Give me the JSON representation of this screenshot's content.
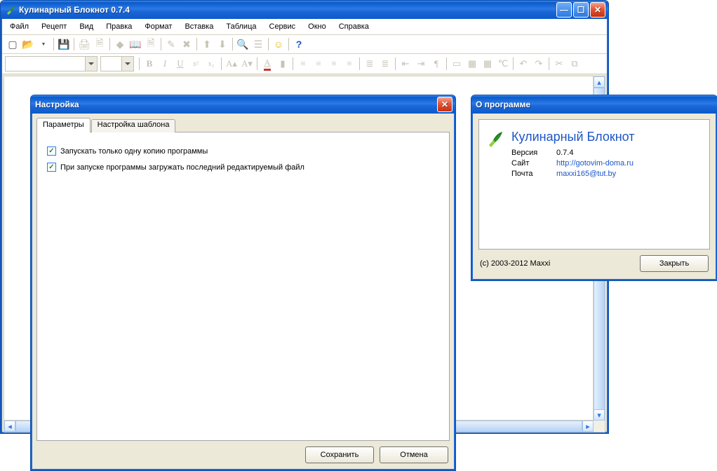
{
  "main": {
    "title": "Кулинарный Блокнот 0.7.4",
    "menu": [
      "Файл",
      "Рецепт",
      "Вид",
      "Правка",
      "Формат",
      "Вставка",
      "Таблица",
      "Сервис",
      "Окно",
      "Справка"
    ]
  },
  "settings": {
    "title": "Настройка",
    "tabs": [
      "Параметры",
      "Настройка шаблона"
    ],
    "checkbox1": "Запускать только одну копию программы",
    "checkbox2": "При запуске программы загружать последний редактируемый файл",
    "save": "Сохранить",
    "cancel": "Отмена"
  },
  "about": {
    "title": "О программе",
    "product": "Кулинарный Блокнот",
    "version_label": "Версия",
    "version_value": "0.7.4",
    "site_label": "Сайт",
    "site_value": "http://gotovim-doma.ru",
    "mail_label": "Почта",
    "mail_value": "maxxi165@tut.by",
    "copyright": "(c) 2003-2012 Maxxi",
    "close": "Закрыть"
  }
}
